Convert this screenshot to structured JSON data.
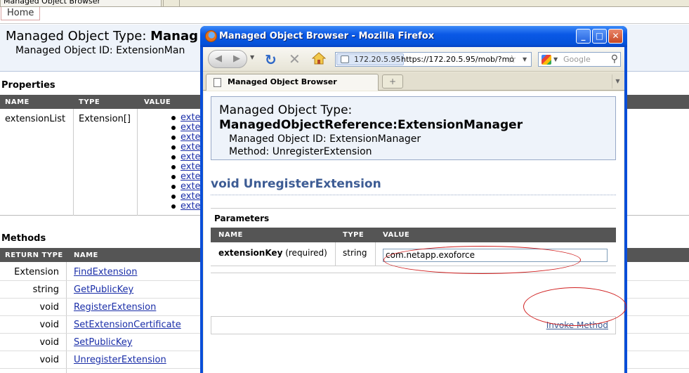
{
  "background_page": {
    "tab_title": "Managed Object Browser",
    "home_link": "Home",
    "header": {
      "type_prefix": "Managed Object Type: ",
      "type_value": "Manag",
      "id_label": "Managed Object ID: ",
      "id_value": "ExtensionMan"
    },
    "properties": {
      "section_title": "Properties",
      "columns": [
        "NAME",
        "TYPE",
        "VALUE"
      ],
      "row": {
        "name": "extensionList",
        "type": "Extension[]",
        "values": [
          "exte",
          "exte",
          "exte",
          "exte",
          "exte",
          "exte",
          "exte",
          "exte",
          "exte",
          "exte"
        ]
      }
    },
    "methods": {
      "section_title": "Methods",
      "columns": [
        "RETURN TYPE",
        "NAME"
      ],
      "rows": [
        {
          "return_type": "Extension",
          "name": "FindExtension"
        },
        {
          "return_type": "string",
          "name": "GetPublicKey"
        },
        {
          "return_type": "void",
          "name": "RegisterExtension"
        },
        {
          "return_type": "void",
          "name": "SetExtensionCertificate"
        },
        {
          "return_type": "void",
          "name": "SetPublicKey"
        },
        {
          "return_type": "void",
          "name": "UnregisterExtension"
        }
      ]
    }
  },
  "popup": {
    "window_title": "Managed Object Browser - Mozilla Firefox",
    "controls": {
      "minimize": "_",
      "maximize": "□",
      "close": "✕"
    },
    "navbar": {
      "identity": "172.20.5.95",
      "url": "https://172.20.5.95/mob/?mo",
      "search_placeholder": "Google"
    },
    "tab_label": "Managed Object Browser",
    "content": {
      "type_label": "Managed Object Type:",
      "type_value": "ManagedObjectReference:ExtensionManager",
      "id_label": "Managed Object ID: ",
      "id_value": "ExtensionManager",
      "method_label": "Method: ",
      "method_value": "UnregisterExtension",
      "method_heading": "void UnregisterExtension",
      "parameters_title": "Parameters",
      "param_columns": [
        "NAME",
        "TYPE",
        "VALUE"
      ],
      "param": {
        "name": "extensionKey",
        "required": " (required)",
        "type": "string",
        "value": "com.netapp.exoforce"
      },
      "invoke_label": "Invoke Method"
    }
  },
  "colors": {
    "title_bar": "#0a58e6",
    "table_header": "#555555",
    "link": "#1a2ea8",
    "highlight": "#d02020",
    "header_background": "#eef3fa"
  }
}
